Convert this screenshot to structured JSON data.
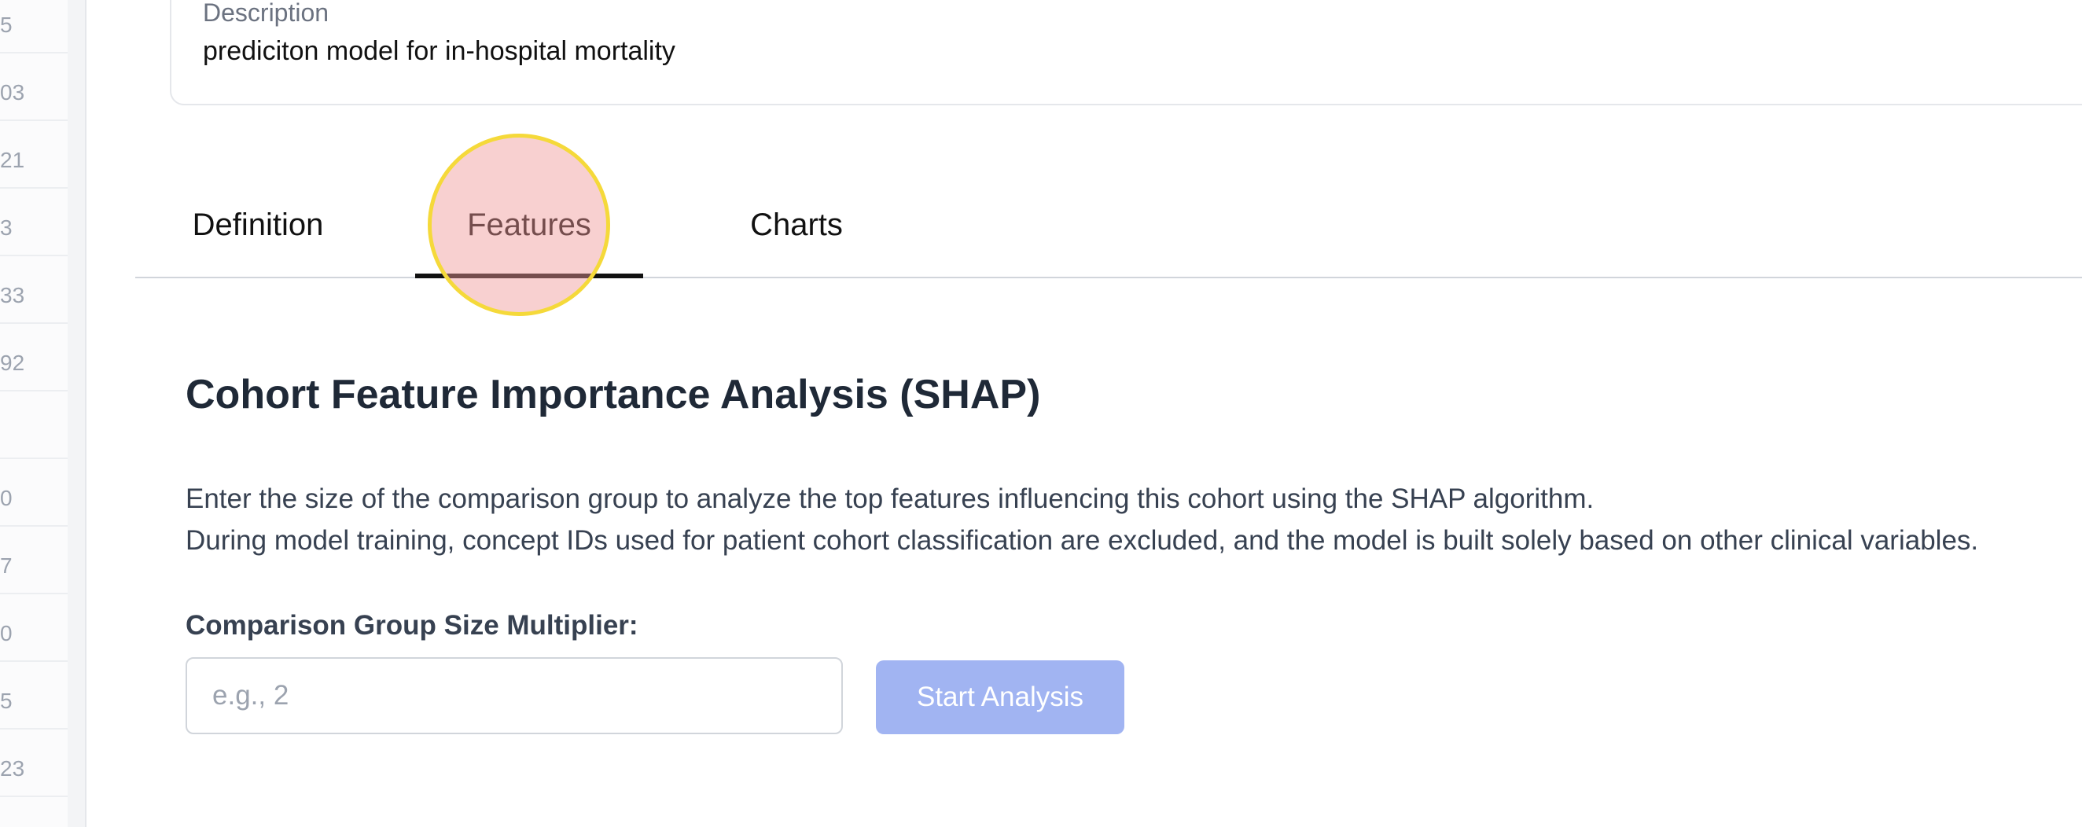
{
  "left_list": {
    "items": [
      "5",
      "03",
      "21",
      "3",
      "33",
      "92",
      "",
      "0",
      "7",
      "0",
      "5",
      "23"
    ]
  },
  "description": {
    "label": "Description",
    "value": "prediciton model for in-hospital mortality"
  },
  "tabs": [
    {
      "label": "Definition",
      "active": false
    },
    {
      "label": "Features",
      "active": true
    },
    {
      "label": "Charts",
      "active": false
    }
  ],
  "shap": {
    "title": "Cohort Feature Importance Analysis (SHAP)",
    "desc_line1": "Enter the size of the comparison group to analyze the top features influencing this cohort using the SHAP algorithm.",
    "desc_line2": "During model training, concept IDs used for patient cohort classification are excluded, and the model is built solely based on other clinical variables.",
    "field_label": "Comparison Group Size Multiplier:",
    "input_placeholder": "e.g., 2",
    "input_value": "",
    "button_label": "Start Analysis"
  },
  "colors": {
    "accent_button": "#a1b4f2",
    "tab_underline": "#111111",
    "click_marker_fill": "#f09696",
    "click_marker_border": "#f5d93a"
  }
}
